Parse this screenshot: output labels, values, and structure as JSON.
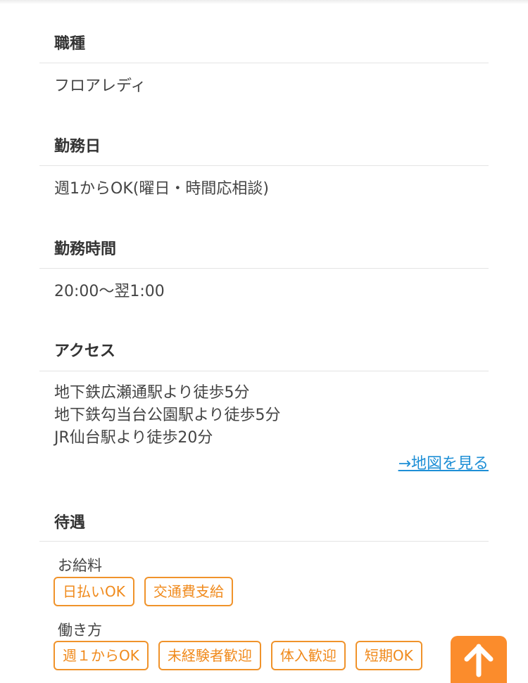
{
  "sections": [
    {
      "title": "職種",
      "lines": [
        "フロアレディ"
      ]
    },
    {
      "title": "勤務日",
      "lines": [
        "週1からOK(曜日・時間応相談)"
      ]
    },
    {
      "title": "勤務時間",
      "lines": [
        "20:00〜翌1:00"
      ]
    },
    {
      "title": "アクセス",
      "lines": [
        "地下鉄広瀬通駅より徒歩5分",
        "地下鉄勾当台公園駅より徒歩5分",
        "JR仙台駅より徒歩20分"
      ],
      "map_link": "→地図を見る"
    },
    {
      "title": "待遇"
    }
  ],
  "benefits": {
    "salary_label": "お給料",
    "salary_tags": [
      "日払いOK",
      "交通費支給"
    ],
    "workstyle_label": "働き方",
    "workstyle_tags": [
      "週１からOK",
      "未経験者歓迎",
      "体入歓迎",
      "短期OK"
    ]
  },
  "colors": {
    "accent": "#f08a1c",
    "link": "#1e8fd6",
    "top_button": "#fb8c2c"
  },
  "icons": {
    "back_to_top": "arrow-up-icon"
  }
}
